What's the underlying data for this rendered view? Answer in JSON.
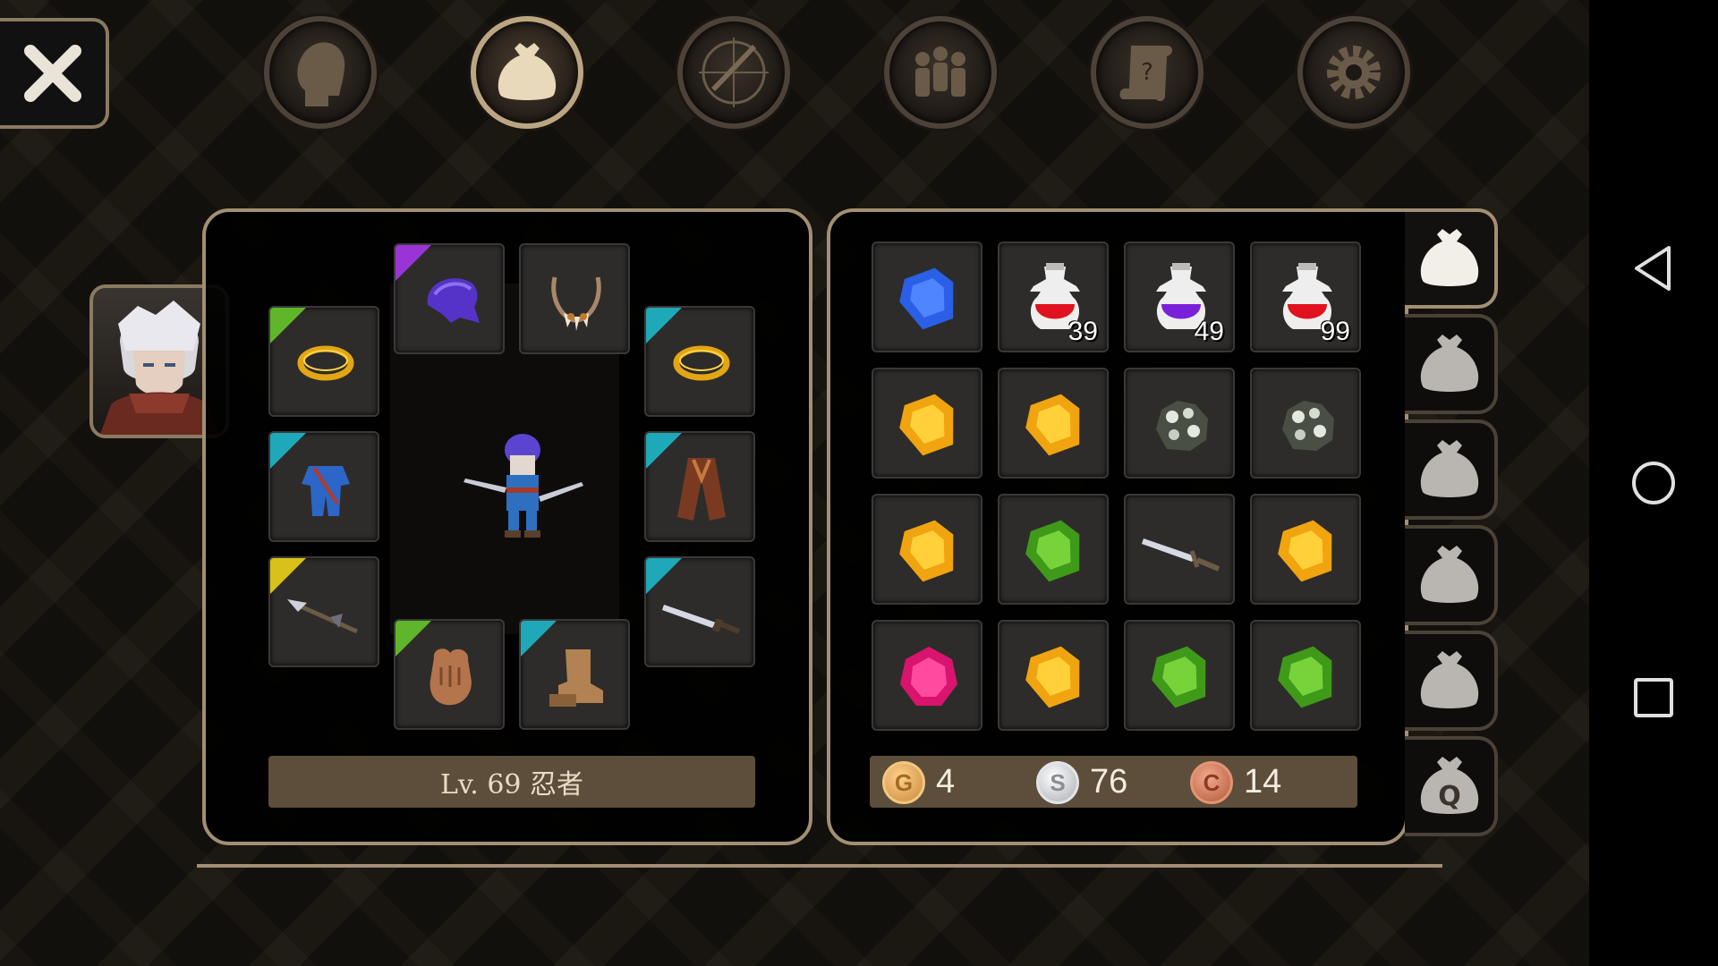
{
  "top_menu": {
    "close": "close-icon",
    "icons": [
      {
        "name": "character-head-icon",
        "active": false
      },
      {
        "name": "bag-icon",
        "active": true
      },
      {
        "name": "skills-compass-sword-icon",
        "active": false
      },
      {
        "name": "party-icon",
        "active": false
      },
      {
        "name": "quest-scroll-icon",
        "active": false
      },
      {
        "name": "settings-gear-icon",
        "active": false
      }
    ]
  },
  "equipment": {
    "level_label": "Lv. 69 忍者",
    "slots": [
      {
        "id": "helmet",
        "icon": "purple-hood-icon",
        "rarity": "#9b34d6"
      },
      {
        "id": "necklace",
        "icon": "fang-necklace-icon",
        "rarity": ""
      },
      {
        "id": "ring-left",
        "icon": "gold-ring-icon",
        "rarity": "#5fb62a"
      },
      {
        "id": "ring-right",
        "icon": "gold-ring-icon",
        "rarity": "#1fa8b8"
      },
      {
        "id": "armor",
        "icon": "blue-ninja-suit-icon",
        "rarity": "#1fa8b8"
      },
      {
        "id": "cloak",
        "icon": "brown-cloak-icon",
        "rarity": "#1fa8b8"
      },
      {
        "id": "weapon-left",
        "icon": "spear-icon",
        "rarity": "#d8c21a"
      },
      {
        "id": "weapon-right",
        "icon": "dagger-icon",
        "rarity": "#1fa8b8"
      },
      {
        "id": "gloves",
        "icon": "leather-glove-icon",
        "rarity": "#5fb62a"
      },
      {
        "id": "boots",
        "icon": "leather-boots-icon",
        "rarity": "#1fa8b8"
      }
    ]
  },
  "inventory": {
    "items": [
      {
        "icon": "blue-gem-icon",
        "qty": ""
      },
      {
        "icon": "red-potion-icon",
        "qty": "39"
      },
      {
        "icon": "purple-potion-icon",
        "qty": "49"
      },
      {
        "icon": "red-potion-icon",
        "qty": "99"
      },
      {
        "icon": "yellow-gem-icon",
        "qty": ""
      },
      {
        "icon": "yellow-gem-icon",
        "qty": ""
      },
      {
        "icon": "ore-icon",
        "qty": ""
      },
      {
        "icon": "ore-icon",
        "qty": ""
      },
      {
        "icon": "yellow-gem-icon",
        "qty": ""
      },
      {
        "icon": "green-gem-icon",
        "qty": ""
      },
      {
        "icon": "dagger-icon",
        "qty": ""
      },
      {
        "icon": "yellow-gem-icon",
        "qty": ""
      },
      {
        "icon": "pink-gem-icon",
        "qty": ""
      },
      {
        "icon": "yellow-gem-icon",
        "qty": ""
      },
      {
        "icon": "green-gem-icon",
        "qty": ""
      },
      {
        "icon": "green-gem-icon",
        "qty": ""
      }
    ],
    "currency": {
      "gold": {
        "symbol": "G",
        "value": "4"
      },
      "silver": {
        "symbol": "S",
        "value": "76"
      },
      "copper": {
        "symbol": "C",
        "value": "14"
      }
    },
    "bag_tabs": [
      {
        "icon": "bag-icon",
        "active": true
      },
      {
        "icon": "bag-icon",
        "active": false
      },
      {
        "icon": "bag-icon",
        "active": false
      },
      {
        "icon": "bag-icon",
        "active": false
      },
      {
        "icon": "bag-icon",
        "active": false
      },
      {
        "icon": "quest-bag-icon",
        "label": "Q",
        "active": false
      }
    ]
  },
  "colors": {
    "panel_border": "#a28f74",
    "bar_fill": "#5c4e3a",
    "rarity_purple": "#9b34d6",
    "rarity_green": "#5fb62a",
    "rarity_cyan": "#1fa8b8",
    "rarity_yellow": "#d8c21a"
  },
  "system_nav": [
    "back-icon",
    "home-icon",
    "recents-icon"
  ]
}
